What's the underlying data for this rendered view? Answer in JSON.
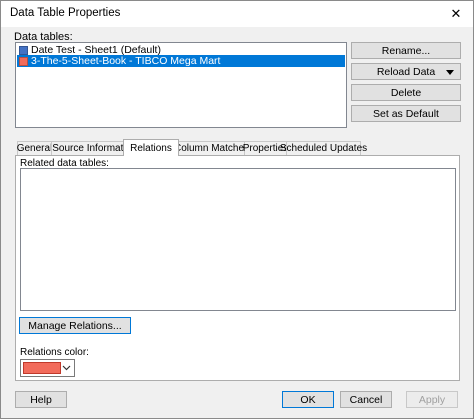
{
  "window": {
    "title": "Data Table Properties",
    "close_glyph": "✕"
  },
  "data_tables": {
    "label": "Data tables:",
    "items": [
      {
        "label": "Date Test - Sheet1 (Default)",
        "color": "#4472c4",
        "selected": false
      },
      {
        "label": "3-The-5-Sheet-Book - TIBCO Mega Mart",
        "color": "#f26b5b",
        "selected": true
      }
    ]
  },
  "side_buttons": {
    "rename": "Rename...",
    "reload": "Reload Data",
    "delete": "Delete",
    "set_default": "Set as Default"
  },
  "tabs": [
    "General",
    "Source Information",
    "Relations",
    "Column Matches",
    "Properties",
    "Scheduled Updates"
  ],
  "active_tab": "Relations",
  "relations": {
    "related_label": "Related data tables:",
    "manage_button": "Manage Relations...",
    "color_label": "Relations color:",
    "color": "#f26b5b"
  },
  "footer": {
    "help": "Help",
    "ok": "OK",
    "cancel": "Cancel",
    "apply": "Apply"
  },
  "icons": {
    "close": "close-icon",
    "dropdown": "dropdown-arrow-icon",
    "chevron": "chevron-down-icon"
  }
}
